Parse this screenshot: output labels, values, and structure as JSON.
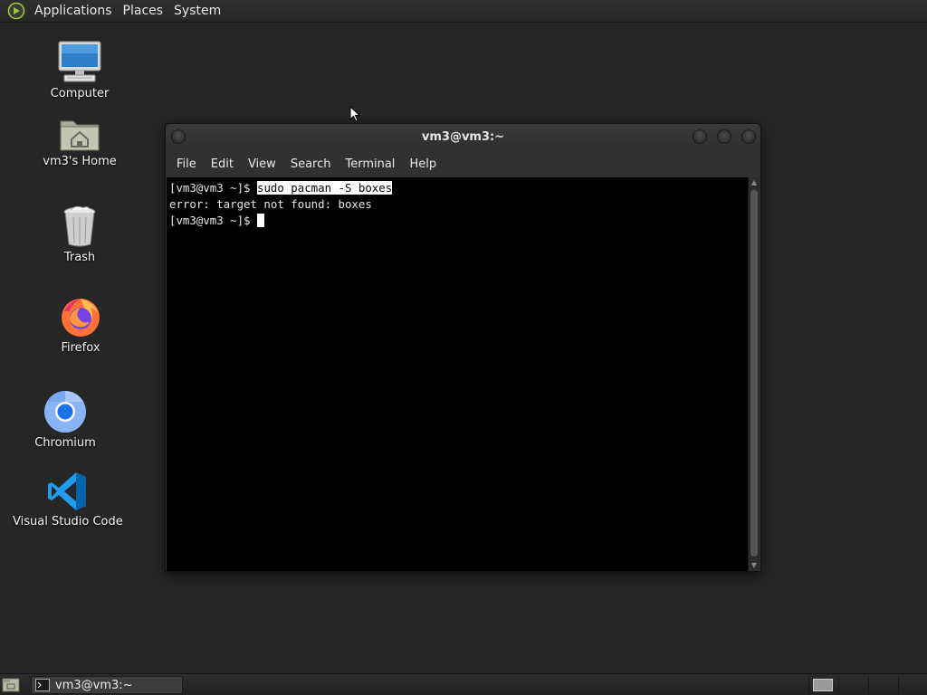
{
  "top_panel": {
    "menus": [
      {
        "label": "Applications"
      },
      {
        "label": "Places"
      },
      {
        "label": "System"
      }
    ]
  },
  "desktop": {
    "icons": [
      {
        "label": "Computer",
        "icon": "computer-icon"
      },
      {
        "label": "vm3's Home",
        "icon": "home-folder-icon"
      },
      {
        "label": "Trash",
        "icon": "trash-icon"
      },
      {
        "label": "Firefox",
        "icon": "firefox-icon"
      },
      {
        "label": "Chromium",
        "icon": "chromium-icon"
      },
      {
        "label": "Visual Studio Code",
        "icon": "vscode-icon"
      }
    ]
  },
  "terminal": {
    "title": "vm3@vm3:~",
    "menus": [
      {
        "label": "File"
      },
      {
        "label": "Edit"
      },
      {
        "label": "View"
      },
      {
        "label": "Search"
      },
      {
        "label": "Terminal"
      },
      {
        "label": "Help"
      }
    ],
    "lines": [
      {
        "prompt": "[vm3@vm3 ~]$ ",
        "command": "sudo pacman -S boxes"
      },
      {
        "text": "error: target not found: boxes"
      },
      {
        "prompt": "[vm3@vm3 ~]$ ",
        "command": ""
      }
    ]
  },
  "taskbar": {
    "tasks": [
      {
        "label": "vm3@vm3:~"
      }
    ]
  },
  "colors": {
    "desktop_bg": "#262626",
    "panel_bg": "#2c2c2c",
    "terminal_bg": "#000000",
    "selection": "#ffffff"
  }
}
